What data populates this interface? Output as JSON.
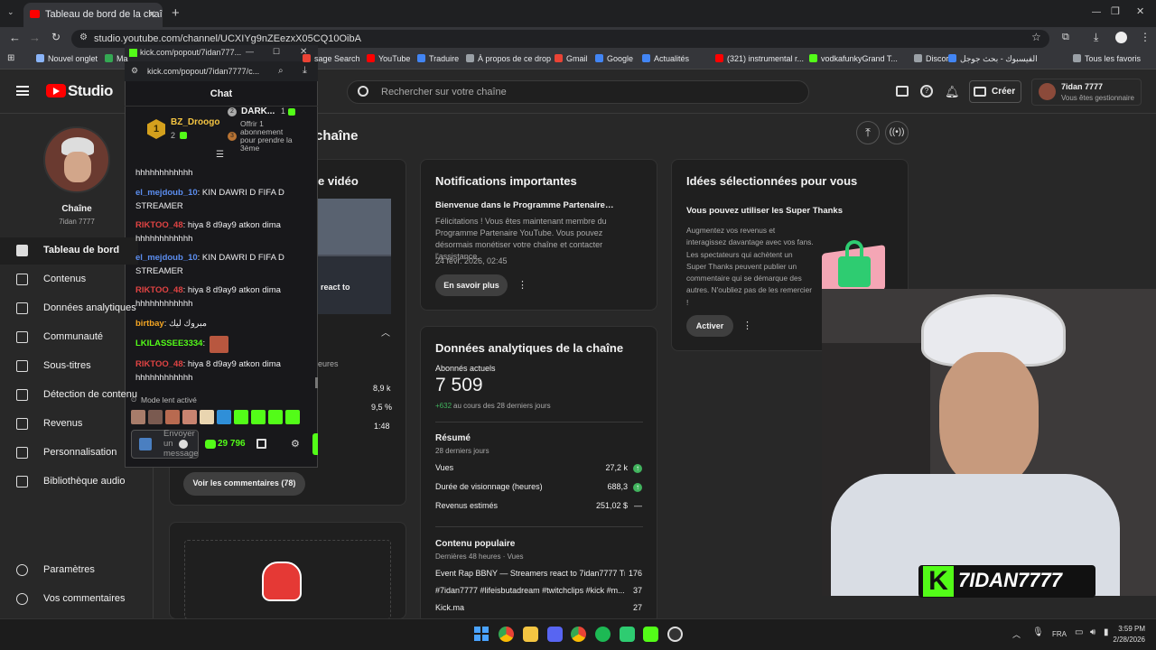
{
  "browser": {
    "tab_title": "Tableau de bord de la chaîne - Yo",
    "url": "studio.youtube.com/channel/UCXIYg9nZEezxX05CQ10OibA",
    "new_tab_symbol": "+"
  },
  "bookmarks": [
    {
      "label": "Nouvel onglet",
      "color": "#8ab4f8"
    },
    {
      "label": "Ma",
      "color": "#34a853"
    },
    {
      "label": "sage Search",
      "color": "#ea4335"
    },
    {
      "label": "YouTube",
      "color": "#ff0000"
    },
    {
      "label": "Traduire",
      "color": "#4285f4"
    },
    {
      "label": "À propos de ce drop",
      "color": "#9aa0a6"
    },
    {
      "label": "Gmail",
      "color": "#ea4335"
    },
    {
      "label": "Google",
      "color": "#4285f4"
    },
    {
      "label": "Actualités",
      "color": "#4285f4"
    },
    {
      "label": "(321) instrumental r...",
      "color": "#ff0000"
    },
    {
      "label": "vodkafunkyGrand T...",
      "color": "#53fc18"
    },
    {
      "label": "Discord",
      "color": "#9aa0a6"
    },
    {
      "label": "الفيسبوك - بحث جوجل",
      "color": "#4285f4"
    },
    {
      "label": "Tous les favoris",
      "color": "#9aa0a6"
    }
  ],
  "studio": {
    "logo": "Studio",
    "search_placeholder": "Rechercher sur votre chaîne",
    "create_label": "Créer",
    "account_name": "7idan 7777",
    "account_sub": "Vous êtes gestionnaire",
    "channel_label": "Chaîne",
    "channel_name": "7idan 7777",
    "page_title": "chaîne",
    "nav": [
      "Tableau de bord",
      "Contenus",
      "Données analytiques",
      "Communauté",
      "Sous-titres",
      "Détection de contenu",
      "Revenus",
      "Personnalisation",
      "Bibliothèque audio"
    ],
    "nav_bottom": [
      "Paramètres",
      "Vos commentaires"
    ]
  },
  "video_card": {
    "title": "e vidéo",
    "thumb_text": "react to",
    "meta": "eures",
    "stats": [
      "8,9 k",
      "9,5 %",
      "1:48"
    ],
    "comments_button": "Voir les commentaires (78)"
  },
  "notifications": {
    "title": "Notifications importantes",
    "heading": "Bienvenue dans le Programme Partenaire…",
    "body": "Félicitations ! Vous êtes maintenant membre du Programme Partenaire YouTube. Vous pouvez désormais monétiser votre chaîne et contacter l'assistance.",
    "date": "24 févr. 2026, 02:45",
    "button": "En savoir plus"
  },
  "analytics": {
    "title": "Données analytiques de la chaîne",
    "subs_label": "Abonnés actuels",
    "subs_value": "7 509",
    "subs_delta": "+632",
    "subs_delta_text": "au cours des 28 derniers jours",
    "summary_title": "Résumé",
    "summary_period": "28 derniers jours",
    "rows": [
      {
        "label": "Vues",
        "value": "27,2 k",
        "trend": "up"
      },
      {
        "label": "Durée de visionnage (heures)",
        "value": "688,3",
        "trend": "up"
      },
      {
        "label": "Revenus estimés",
        "value": "251,02 $",
        "trend": "—"
      }
    ],
    "popular_title": "Contenu populaire",
    "popular_period": "Dernières 48 heures · Vues",
    "popular": [
      {
        "title": "Event Rap BBNY — Streamers react to 7idan7777 Tra...",
        "views": "176"
      },
      {
        "title": "#7idan7777 #lifeisbutadream #twitchclips #kick #m...",
        "views": "37"
      },
      {
        "title": "Kick.ma",
        "views": "27"
      }
    ]
  },
  "ideas": {
    "title": "Idées sélectionnées pour vous",
    "heading": "Vous pouvez utiliser les Super Thanks",
    "body": "Augmentez vos revenus et interagissez davantage avec vos fans. Les spectateurs qui achètent un Super Thanks peuvent publier un commentaire qui se démarque des autres. N'oubliez pas de les remercier !",
    "button": "Activer"
  },
  "popup": {
    "window_title": "kick.com/popout/7idan777...",
    "url": "kick.com/popout/7idan7777/c...",
    "chat_title": "Chat",
    "top1_name": "BZ_Droogo",
    "top1_count": "2",
    "top1_rank": "1",
    "top2_name": "DARK...",
    "top2_count": "1",
    "top2_rank": "2",
    "top3_text": "Offrir 1 abonnement pour prendre la 3ème",
    "top3_rank": "3",
    "messages": [
      {
        "user": "",
        "text": "hhhhhhhhhhhh",
        "color": "#efeff1"
      },
      {
        "user": "el_mejdoub_10",
        "text": ": KIN DAWRI D FIFA D STREAMER",
        "color": "#5b8def"
      },
      {
        "user": "RIKTOO_48",
        "text": ": hiya 8 d9ay9 atkon dima hhhhhhhhhhhh",
        "color": "#e04343"
      },
      {
        "user": "el_mejdoub_10",
        "text": ": KIN DAWRI D FIFA D STREAMER",
        "color": "#5b8def"
      },
      {
        "user": "RIKTOO_48",
        "text": ": hiya 8 d9ay9 atkon dima hhhhhhhhhhhh",
        "color": "#e04343"
      },
      {
        "user": "birtbay",
        "text": ": مبروك ليك",
        "color": "#f5a623"
      },
      {
        "user": "LKILASSEE3334",
        "text": ":",
        "color": "#53fc18"
      },
      {
        "user": "RIKTOO_48",
        "text": ": hiya 8 d9ay9 atkon dima hhhhhhhhhhhh",
        "color": "#e04343"
      }
    ],
    "slow_mode": "Mode lent activé",
    "send_placeholder": "Envoyer un message",
    "points": "29 796"
  },
  "overlay": {
    "logo_letter": "K",
    "name": "7IDAN7777"
  },
  "taskbar": {
    "lang": "FRA",
    "time": "3:59 PM",
    "date": "2/28/2026"
  }
}
